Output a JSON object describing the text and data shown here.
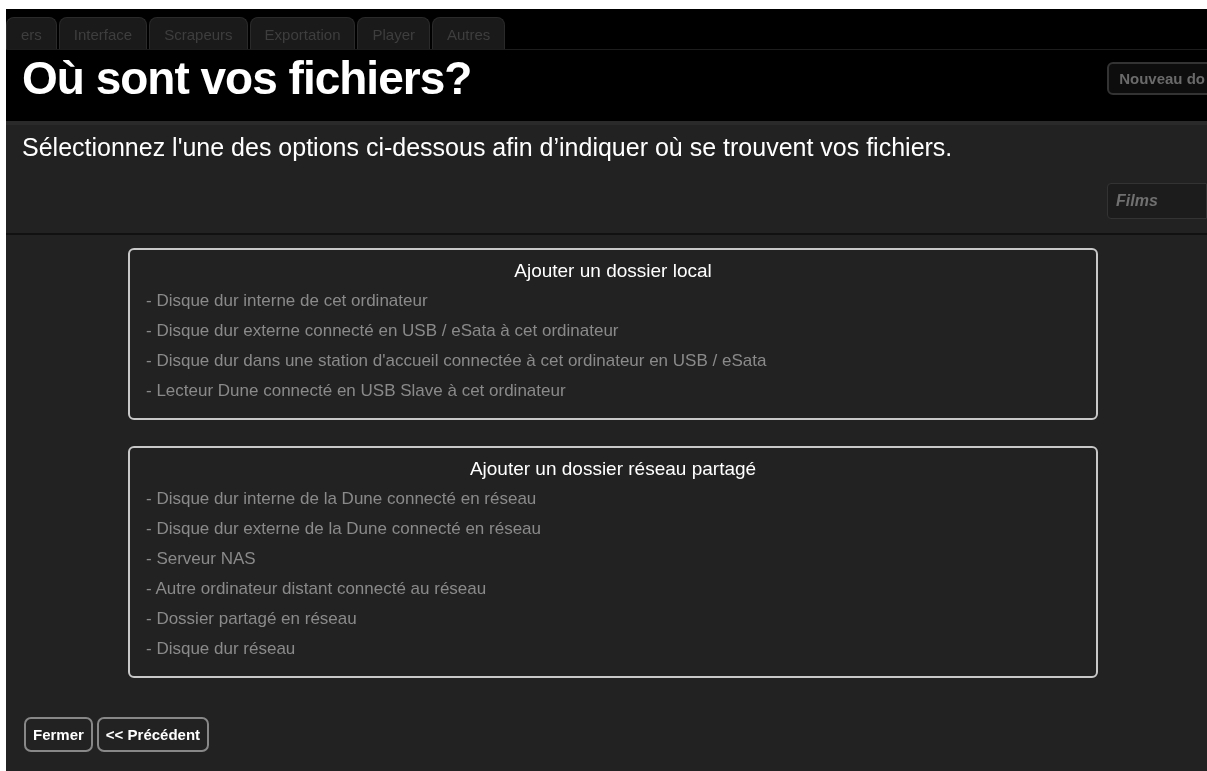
{
  "background_app": {
    "tabs": [
      {
        "label": "ers"
      },
      {
        "label": "Interface"
      },
      {
        "label": "Scrapeurs"
      },
      {
        "label": "Exportation"
      },
      {
        "label": "Player"
      },
      {
        "label": "Autres"
      }
    ],
    "new_folder_button": "Nouveau do",
    "category_field": {
      "value": "Films"
    }
  },
  "dialog": {
    "title": "Où sont vos fichiers?",
    "subtitle": "Sélectionnez l'une des options ci-dessous afin d’indiquer où se trouvent vos fichiers.",
    "options": [
      {
        "title": "Ajouter un dossier local",
        "items": [
          "- Disque dur interne de cet ordinateur",
          "- Disque dur externe connecté en USB / eSata à cet ordinateur",
          "- Disque dur dans une station d'accueil connectée à cet ordinateur en USB / eSata",
          "- Lecteur Dune connecté en USB Slave à cet ordinateur"
        ]
      },
      {
        "title": "Ajouter un dossier réseau partagé",
        "items": [
          "- Disque dur interne de la Dune connecté en réseau",
          "- Disque dur externe de la Dune connecté en réseau",
          "- Serveur NAS",
          "- Autre ordinateur distant connecté au réseau",
          "- Dossier partagé en réseau",
          "- Disque dur réseau"
        ]
      }
    ],
    "buttons": [
      "Fermer",
      "<< Précédent"
    ]
  }
}
